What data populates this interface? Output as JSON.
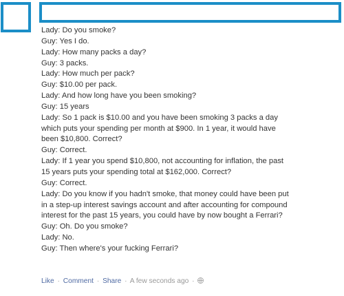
{
  "colors": {
    "redaction_border": "#1b8ec7",
    "text": "#333333",
    "link": "#4e69a2",
    "meta": "#999999"
  },
  "post": {
    "lines": [
      "Lady: Do you smoke?",
      "Guy: Yes I do.",
      "Lady: How many packs a day?",
      "Guy: 3 packs.",
      "Lady: How much per pack?",
      "Guy: $10.00 per pack.",
      "Lady: And how long have you been smoking?",
      "Guy: 15 years",
      "Lady: So 1 pack is $10.00 and you have been smoking 3 packs a day",
      "which puts your spending per month at $900. In 1 year, it would have",
      "been $10,800. Correct?",
      "Guy: Correct.",
      "Lady: If 1 year you spend $10,800, not accounting for inflation, the past",
      "15 years puts your spending total at $162,000. Correct?",
      "Guy: Correct.",
      "Lady: Do you know if you hadn't smoke, that money could have been put",
      "in a step-up interest savings account and after accounting for compound",
      "interest for the past 15 years, you could have by now bought a Ferrari?",
      "Guy: Oh. Do you smoke?",
      "Lady: No.",
      "Guy: Then where's your fucking Ferrari?"
    ]
  },
  "footer": {
    "like_label": "Like",
    "comment_label": "Comment",
    "share_label": "Share",
    "separator": "·",
    "timestamp": "A few seconds ago",
    "privacy_icon": "globe-icon"
  }
}
